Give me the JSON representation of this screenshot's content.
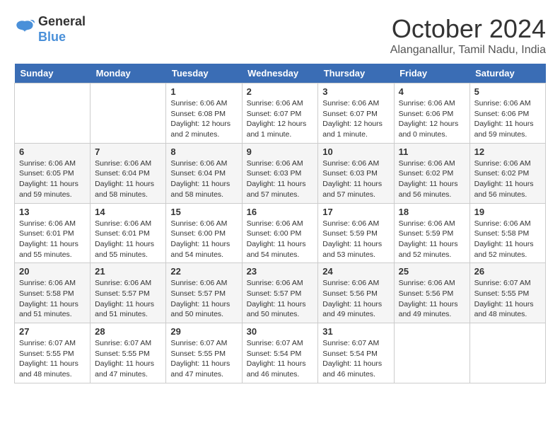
{
  "header": {
    "logo_line1": "General",
    "logo_line2": "Blue",
    "month": "October 2024",
    "location": "Alanganallur, Tamil Nadu, India"
  },
  "weekdays": [
    "Sunday",
    "Monday",
    "Tuesday",
    "Wednesday",
    "Thursday",
    "Friday",
    "Saturday"
  ],
  "weeks": [
    [
      {
        "day": "",
        "info": ""
      },
      {
        "day": "",
        "info": ""
      },
      {
        "day": "1",
        "info": "Sunrise: 6:06 AM\nSunset: 6:08 PM\nDaylight: 12 hours\nand 2 minutes."
      },
      {
        "day": "2",
        "info": "Sunrise: 6:06 AM\nSunset: 6:07 PM\nDaylight: 12 hours\nand 1 minute."
      },
      {
        "day": "3",
        "info": "Sunrise: 6:06 AM\nSunset: 6:07 PM\nDaylight: 12 hours\nand 1 minute."
      },
      {
        "day": "4",
        "info": "Sunrise: 6:06 AM\nSunset: 6:06 PM\nDaylight: 12 hours\nand 0 minutes."
      },
      {
        "day": "5",
        "info": "Sunrise: 6:06 AM\nSunset: 6:06 PM\nDaylight: 11 hours\nand 59 minutes."
      }
    ],
    [
      {
        "day": "6",
        "info": "Sunrise: 6:06 AM\nSunset: 6:05 PM\nDaylight: 11 hours\nand 59 minutes."
      },
      {
        "day": "7",
        "info": "Sunrise: 6:06 AM\nSunset: 6:04 PM\nDaylight: 11 hours\nand 58 minutes."
      },
      {
        "day": "8",
        "info": "Sunrise: 6:06 AM\nSunset: 6:04 PM\nDaylight: 11 hours\nand 58 minutes."
      },
      {
        "day": "9",
        "info": "Sunrise: 6:06 AM\nSunset: 6:03 PM\nDaylight: 11 hours\nand 57 minutes."
      },
      {
        "day": "10",
        "info": "Sunrise: 6:06 AM\nSunset: 6:03 PM\nDaylight: 11 hours\nand 57 minutes."
      },
      {
        "day": "11",
        "info": "Sunrise: 6:06 AM\nSunset: 6:02 PM\nDaylight: 11 hours\nand 56 minutes."
      },
      {
        "day": "12",
        "info": "Sunrise: 6:06 AM\nSunset: 6:02 PM\nDaylight: 11 hours\nand 56 minutes."
      }
    ],
    [
      {
        "day": "13",
        "info": "Sunrise: 6:06 AM\nSunset: 6:01 PM\nDaylight: 11 hours\nand 55 minutes."
      },
      {
        "day": "14",
        "info": "Sunrise: 6:06 AM\nSunset: 6:01 PM\nDaylight: 11 hours\nand 55 minutes."
      },
      {
        "day": "15",
        "info": "Sunrise: 6:06 AM\nSunset: 6:00 PM\nDaylight: 11 hours\nand 54 minutes."
      },
      {
        "day": "16",
        "info": "Sunrise: 6:06 AM\nSunset: 6:00 PM\nDaylight: 11 hours\nand 54 minutes."
      },
      {
        "day": "17",
        "info": "Sunrise: 6:06 AM\nSunset: 5:59 PM\nDaylight: 11 hours\nand 53 minutes."
      },
      {
        "day": "18",
        "info": "Sunrise: 6:06 AM\nSunset: 5:59 PM\nDaylight: 11 hours\nand 52 minutes."
      },
      {
        "day": "19",
        "info": "Sunrise: 6:06 AM\nSunset: 5:58 PM\nDaylight: 11 hours\nand 52 minutes."
      }
    ],
    [
      {
        "day": "20",
        "info": "Sunrise: 6:06 AM\nSunset: 5:58 PM\nDaylight: 11 hours\nand 51 minutes."
      },
      {
        "day": "21",
        "info": "Sunrise: 6:06 AM\nSunset: 5:57 PM\nDaylight: 11 hours\nand 51 minutes."
      },
      {
        "day": "22",
        "info": "Sunrise: 6:06 AM\nSunset: 5:57 PM\nDaylight: 11 hours\nand 50 minutes."
      },
      {
        "day": "23",
        "info": "Sunrise: 6:06 AM\nSunset: 5:57 PM\nDaylight: 11 hours\nand 50 minutes."
      },
      {
        "day": "24",
        "info": "Sunrise: 6:06 AM\nSunset: 5:56 PM\nDaylight: 11 hours\nand 49 minutes."
      },
      {
        "day": "25",
        "info": "Sunrise: 6:06 AM\nSunset: 5:56 PM\nDaylight: 11 hours\nand 49 minutes."
      },
      {
        "day": "26",
        "info": "Sunrise: 6:07 AM\nSunset: 5:55 PM\nDaylight: 11 hours\nand 48 minutes."
      }
    ],
    [
      {
        "day": "27",
        "info": "Sunrise: 6:07 AM\nSunset: 5:55 PM\nDaylight: 11 hours\nand 48 minutes."
      },
      {
        "day": "28",
        "info": "Sunrise: 6:07 AM\nSunset: 5:55 PM\nDaylight: 11 hours\nand 47 minutes."
      },
      {
        "day": "29",
        "info": "Sunrise: 6:07 AM\nSunset: 5:55 PM\nDaylight: 11 hours\nand 47 minutes."
      },
      {
        "day": "30",
        "info": "Sunrise: 6:07 AM\nSunset: 5:54 PM\nDaylight: 11 hours\nand 46 minutes."
      },
      {
        "day": "31",
        "info": "Sunrise: 6:07 AM\nSunset: 5:54 PM\nDaylight: 11 hours\nand 46 minutes."
      },
      {
        "day": "",
        "info": ""
      },
      {
        "day": "",
        "info": ""
      }
    ]
  ]
}
